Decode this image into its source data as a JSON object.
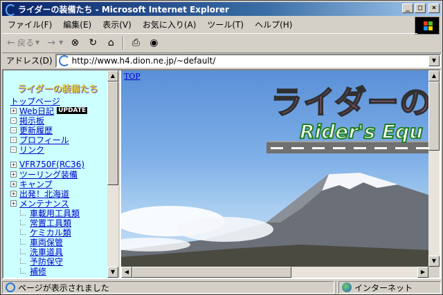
{
  "window": {
    "title": "ライダーの装備たち - Microsoft Internet Explorer",
    "minimize": "_",
    "maximize": "□",
    "close": "×"
  },
  "menu": [
    "ファイル(F)",
    "編集(E)",
    "表示(V)",
    "お気に入り(A)",
    "ツール(T)",
    "ヘルプ(H)"
  ],
  "toolbar": {
    "back_label": "戻る",
    "forward_icon": "arrow-right-icon",
    "stop_icon": "stop-icon",
    "refresh_icon": "refresh-icon",
    "home_icon": "home-icon",
    "print_icon": "print-icon",
    "media_icon": "media-icon"
  },
  "address": {
    "label": "アドレス(D)",
    "url": "http://www.h4.dion.ne.jp/~default/"
  },
  "left_frame": {
    "logo": "ライダーの装備たち",
    "items": [
      {
        "label": "トップページ",
        "marker": ""
      },
      {
        "label": "Web日記",
        "marker": "+",
        "badge": "UPDATE"
      },
      {
        "label": "掲示板",
        "marker": "-"
      },
      {
        "label": "更新履歴",
        "marker": "-"
      },
      {
        "label": "プロフィール",
        "marker": "-"
      },
      {
        "label": "リンク",
        "marker": "-"
      }
    ],
    "items2": [
      {
        "label": "VFR750F(RC36)",
        "marker": "+"
      },
      {
        "label": "ツーリング装備",
        "marker": "+"
      },
      {
        "label": "キャンプ",
        "marker": "+"
      },
      {
        "label": "出発！北海道",
        "marker": "+"
      },
      {
        "label": "メンテナンス",
        "marker": "+"
      }
    ],
    "subitems": [
      "車載用工具類",
      "常置工具類",
      "ケミカル類",
      "車両保管",
      "洗車道具",
      "予防保守",
      "補修"
    ]
  },
  "right_frame": {
    "top_link": "TOP",
    "big_title": "ライダーの装",
    "sub_title": "Rider's Equ"
  },
  "status": {
    "text": "ページが表示されました",
    "zone": "インターネット"
  },
  "colors": {
    "title_bar": "#0a246a",
    "left_frame_bg": "#ccffff",
    "link": "#0000cc",
    "title_pink": "#ff80c0"
  }
}
